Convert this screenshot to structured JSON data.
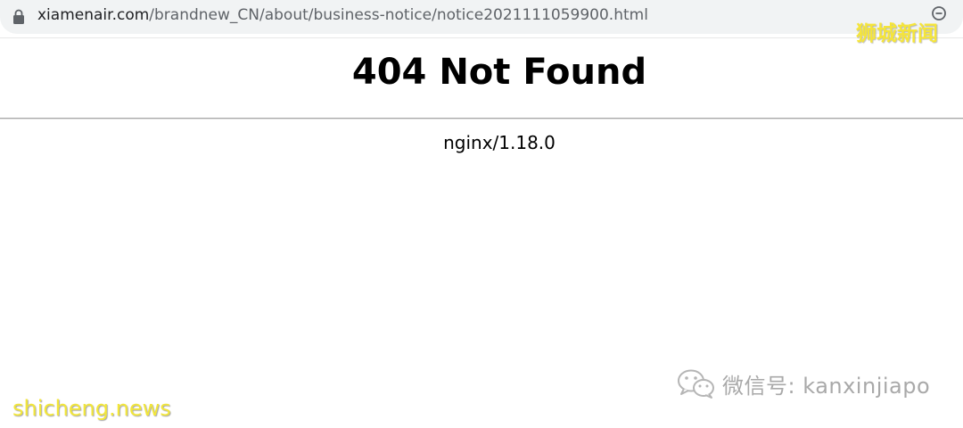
{
  "browser": {
    "url_domain": "xiamenair.com",
    "url_path": "/brandnew_CN/about/business-notice/notice2021111059900.html",
    "lock_icon": "lock-icon",
    "zoom_icon": "zoom-out-icon"
  },
  "page": {
    "heading": "404 Not Found",
    "server_signature": "nginx/1.18.0"
  },
  "watermarks": {
    "top_right": "狮城新闻",
    "wechat_label": "微信号: kanxinjiapo",
    "bottom_left": "shicheng.news",
    "color": "#f5e53a"
  }
}
